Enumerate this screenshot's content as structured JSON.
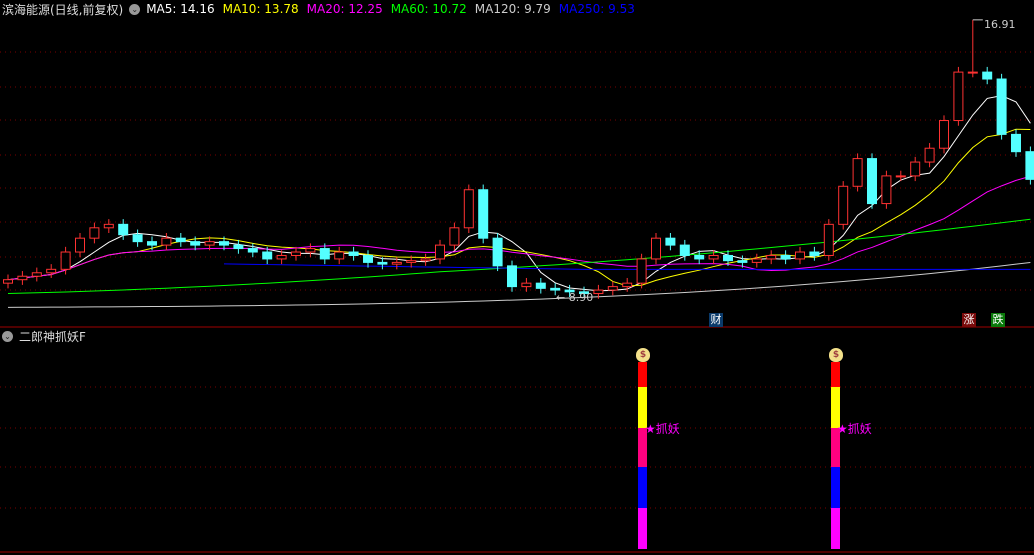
{
  "header": {
    "title": "滨海能源(日线,前复权)",
    "ma": [
      {
        "label": "MA5: 14.16",
        "color": "#ffffff"
      },
      {
        "label": "MA10: 13.78",
        "color": "#ffff00"
      },
      {
        "label": "MA20: 12.25",
        "color": "#ff00ff"
      },
      {
        "label": "MA60: 10.72",
        "color": "#00ff00"
      },
      {
        "label": "MA120: 9.79",
        "color": "#cccccc"
      },
      {
        "label": "MA250: 9.53",
        "color": "#0000ff"
      }
    ]
  },
  "price_chart": {
    "high_label": "16.91",
    "low_label": "8.90",
    "closes": [
      9.4,
      9.5,
      9.6,
      9.7,
      10.2,
      10.6,
      10.9,
      11.0,
      10.7,
      10.5,
      10.4,
      10.6,
      10.5,
      10.4,
      10.5,
      10.4,
      10.3,
      10.2,
      10.0,
      10.1,
      10.2,
      10.3,
      10.0,
      10.2,
      10.1,
      9.9,
      9.85,
      9.9,
      9.95,
      10.0,
      10.4,
      10.9,
      12.0,
      10.6,
      9.8,
      9.2,
      9.3,
      9.15,
      9.1,
      9.05,
      9.0,
      9.1,
      9.2,
      9.3,
      10.0,
      10.6,
      10.4,
      10.1,
      10.0,
      10.1,
      9.95,
      9.9,
      10.0,
      10.1,
      10.0,
      10.2,
      10.1,
      11.0,
      12.1,
      12.9,
      11.6,
      12.4,
      12.4,
      12.8,
      13.2,
      14.0,
      15.4,
      15.4,
      15.2,
      13.6,
      13.1,
      12.3
    ],
    "high_index": 67,
    "low_index": 40,
    "up_color": "#ff3232",
    "down_color": "#54ffff",
    "markers": {
      "cai": "财",
      "zhang": "涨",
      "die": "跌"
    }
  },
  "indicator": {
    "title": "二郎神抓妖F",
    "signal_label": "★抓妖",
    "bag_symbol": "$",
    "signal_indices": [
      44,
      57
    ],
    "band_colors": [
      "#ff0000",
      "#ffff00",
      "#ff0080",
      "#0000ff",
      "#ff00ff"
    ]
  }
}
